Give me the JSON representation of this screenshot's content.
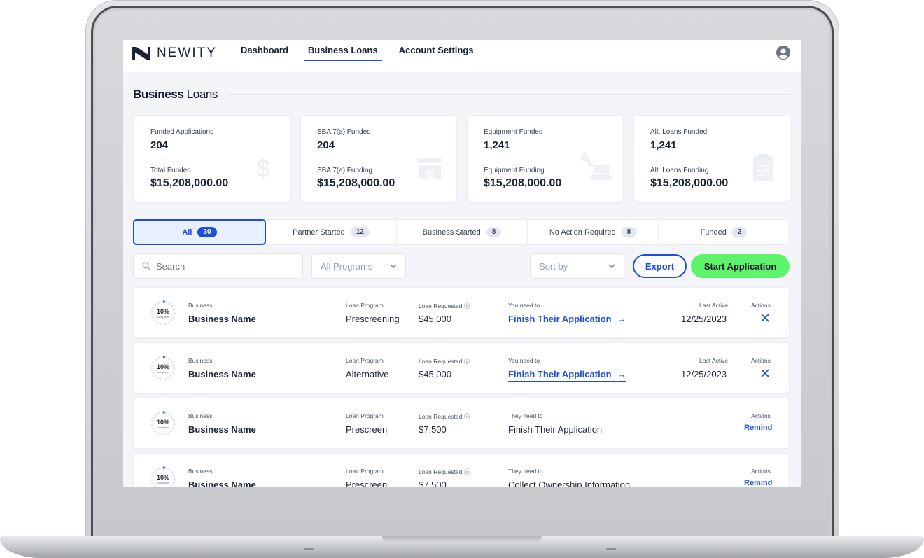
{
  "brand": {
    "name": "NEWITY"
  },
  "nav": [
    {
      "label": "Dashboard",
      "active": false
    },
    {
      "label": "Business Loans",
      "active": true
    },
    {
      "label": "Account Settings",
      "active": false
    }
  ],
  "page": {
    "title_bold": "Business",
    "title_rest": "Loans"
  },
  "stats": [
    {
      "label_top": "Funded Applications",
      "value_top": "204",
      "label_bottom": "Total Funded",
      "value_bottom": "$15,208,000.00",
      "icon": "dollar-icon"
    },
    {
      "label_top": "SBA 7(a) Funded",
      "value_top": "204",
      "label_bottom": "SBA 7(a) Funding",
      "value_bottom": "$15,208,000.00",
      "icon": "storefront-icon"
    },
    {
      "label_top": "Equipment Funded",
      "value_top": "1,241",
      "label_bottom": "Equipment Funding",
      "value_bottom": "$15,208,000.00",
      "icon": "excavator-icon"
    },
    {
      "label_top": "Alt. Loans Funded",
      "value_top": "1,241",
      "label_bottom": "Alt. Loans Funding",
      "value_bottom": "$15,208,000.00",
      "icon": "clipboard-icon"
    }
  ],
  "tabs": [
    {
      "label": "All",
      "count": "30",
      "active": true
    },
    {
      "label": "Partner Started",
      "count": "12",
      "active": false
    },
    {
      "label": "Business Started",
      "count": "8",
      "active": false
    },
    {
      "label": "No Action Required",
      "count": "8",
      "active": false
    },
    {
      "label": "Funded",
      "count": "2",
      "active": false
    }
  ],
  "controls": {
    "search_placeholder": "Search",
    "programs_value": "All Programs",
    "sort_value": "Sort by",
    "export_label": "Export",
    "start_label": "Start Application"
  },
  "columns": {
    "business": "Business",
    "program": "Loan Program",
    "requested": "Loan Requested",
    "last_active": "Last Active",
    "actions": "Actions"
  },
  "rows": [
    {
      "progress": "10%",
      "progress_sub": "complete",
      "business": "Business Name",
      "program": "Prescreening",
      "requested": "$45,000",
      "need_label": "You need to",
      "need_value": "Finish Their Application",
      "need_is_link": true,
      "last_active": "12/25/2023",
      "action": "close"
    },
    {
      "progress": "10%",
      "progress_sub": "complete",
      "business": "Business Name",
      "program": "Alternative",
      "requested": "$45,000",
      "need_label": "You need to",
      "need_value": "Finish Their Application",
      "need_is_link": true,
      "last_active": "12/25/2023",
      "action": "close"
    },
    {
      "progress": "10%",
      "progress_sub": "complete",
      "business": "Business Name",
      "program": "Prescreen",
      "requested": "$7,500",
      "need_label": "They need to",
      "need_value": "Finish Their Application",
      "need_is_link": false,
      "last_active": "",
      "action": "Remind"
    },
    {
      "progress": "10%",
      "progress_sub": "complete",
      "business": "Business Name",
      "program": "Prescreen",
      "requested": "$7,500",
      "need_label": "They need to",
      "need_value": "Collect Ownership Information",
      "need_is_link": false,
      "last_active": "",
      "action": "Remind"
    }
  ],
  "colors": {
    "primary": "#1d4fd8",
    "accent_green": "#5df36a",
    "text": "#1b2437",
    "background": "#f4f5f8"
  }
}
